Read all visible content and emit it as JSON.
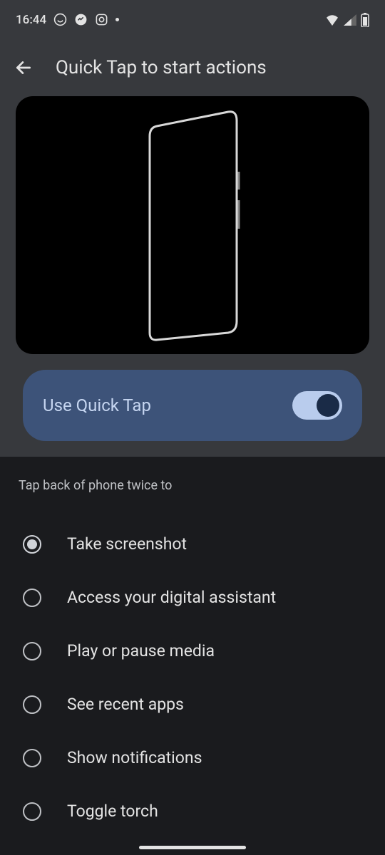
{
  "statusBar": {
    "time": "16:44"
  },
  "header": {
    "title": "Quick Tap to start actions"
  },
  "toggle": {
    "label": "Use Quick Tap",
    "enabled": true
  },
  "sectionLabel": "Tap back of phone twice to",
  "options": [
    {
      "label": "Take screenshot",
      "selected": true
    },
    {
      "label": "Access your digital assistant",
      "selected": false
    },
    {
      "label": "Play or pause media",
      "selected": false
    },
    {
      "label": "See recent apps",
      "selected": false
    },
    {
      "label": "Show notifications",
      "selected": false
    },
    {
      "label": "Toggle torch",
      "selected": false
    }
  ]
}
